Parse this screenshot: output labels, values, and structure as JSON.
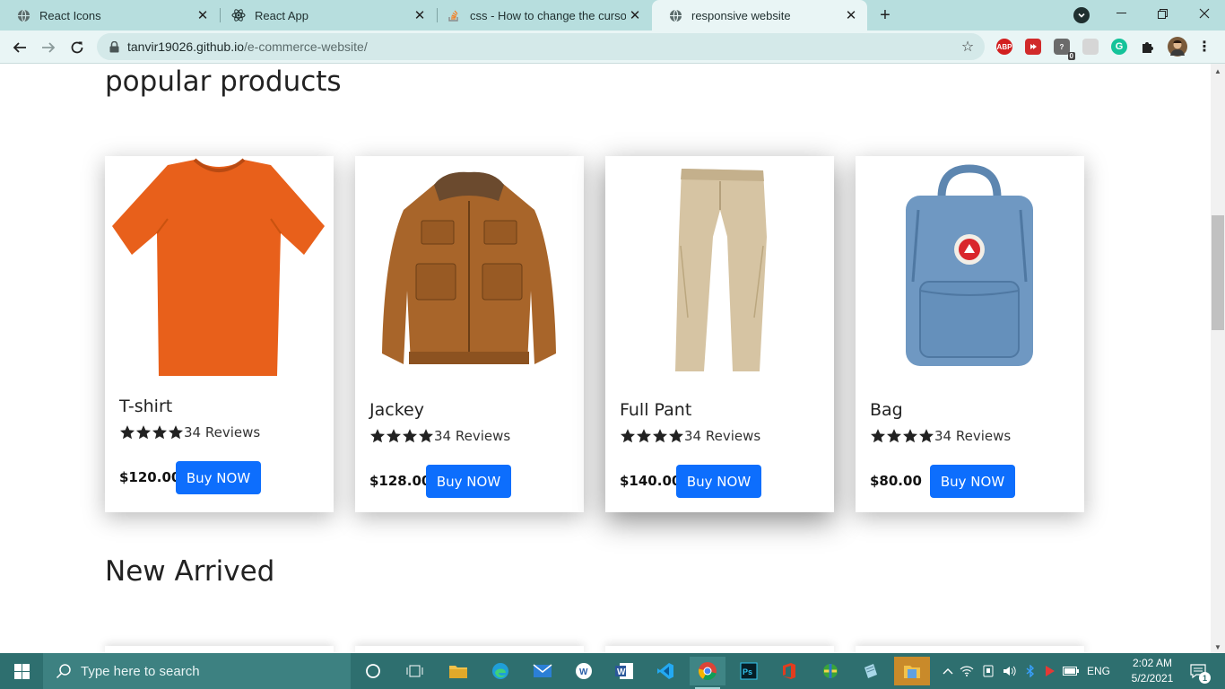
{
  "browser": {
    "tabs": [
      {
        "title": "React Icons",
        "icon": "globe-icon"
      },
      {
        "title": "React App",
        "icon": "react-icon"
      },
      {
        "title": "css - How to change the cursor in",
        "icon": "stackoverflow-icon"
      },
      {
        "title": "responsive website",
        "icon": "globe-icon",
        "active": true
      }
    ],
    "url_host": "tanvir19026.github.io",
    "url_path": "/e-commerce-website/",
    "extensions": [
      {
        "name": "adblock-plus-icon",
        "label": "ABP",
        "color": "#d21f1f"
      },
      {
        "name": "extension-red-icon",
        "label": "",
        "color": "#d12a2a"
      },
      {
        "name": "help-extension-icon",
        "label": "0",
        "color": "#6b6b6b"
      },
      {
        "name": "blank-extension-icon",
        "label": "",
        "color": "#d6d6d6"
      },
      {
        "name": "grammarly-icon",
        "label": "G",
        "color": "#15c39a"
      },
      {
        "name": "puzzle-icon",
        "label": "",
        "color": "#222222"
      },
      {
        "name": "profile-avatar",
        "label": "",
        "color": "#7a5a3a"
      }
    ]
  },
  "page": {
    "popular_title": "popular products",
    "new_title": "New Arrived",
    "products": [
      {
        "name": "T-shirt",
        "rating": 4,
        "reviews": "34 Reviews",
        "price": "$120.00",
        "button": "Buy NOW",
        "image": "orange-tshirt"
      },
      {
        "name": "Jackey",
        "rating": 4,
        "reviews": "34 Reviews",
        "price": "$128.00",
        "button": "Buy NOW",
        "image": "brown-jacket"
      },
      {
        "name": "Full Pant",
        "rating": 4,
        "reviews": "34 Reviews",
        "price": "$140.00",
        "button": "Buy NOW",
        "image": "khaki-pants"
      },
      {
        "name": "Bag",
        "rating": 4,
        "reviews": "34 Reviews",
        "price": "$80.00",
        "button": "Buy NOW",
        "image": "blue-backpack"
      }
    ],
    "accent_color": "#0d6efd"
  },
  "taskbar": {
    "search_placeholder": "Type here to search",
    "language": "ENG",
    "time": "2:02 AM",
    "date": "5/2/2021",
    "notification_count": "1"
  }
}
